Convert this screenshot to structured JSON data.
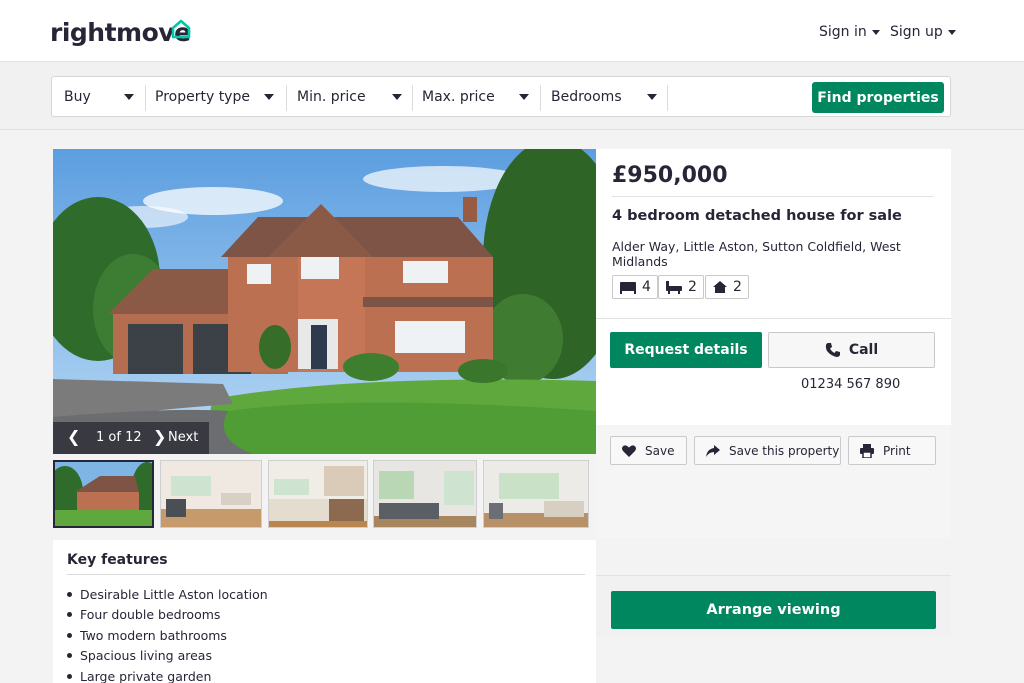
{
  "header": {
    "logo_text": "rightmove",
    "sign_in": "Sign in",
    "sign_up": "Sign up"
  },
  "search": {
    "filters": [
      "Buy",
      "Property type",
      "Min. price",
      "Max. price",
      "Bedrooms"
    ],
    "find_label": "Find properties"
  },
  "gallery": {
    "counter": "1 of 12",
    "next_label": "Next"
  },
  "listing": {
    "price": "£950,000",
    "title": "4 bedroom detached house for sale",
    "address": "Alder Way, Little Aston, Sutton Coldfield, West Midlands",
    "bedrooms": "4",
    "bathrooms": "2",
    "receptions": "2",
    "request_label": "Request details",
    "call_label": "Call",
    "phone": "01234 567 890",
    "save_label": "Save",
    "save_property_label": "Save this property",
    "print_label": "Print"
  },
  "features": {
    "heading": "Key features",
    "items": [
      "Desirable Little Aston location",
      "Four double bedrooms",
      "Two modern bathrooms",
      "Spacious living areas",
      "Large private garden"
    ]
  },
  "viewing": {
    "label": "Arrange viewing"
  },
  "colors": {
    "brand_green": "#00875f",
    "text_dark": "#262637",
    "logo_accent": "#00c9a7"
  }
}
